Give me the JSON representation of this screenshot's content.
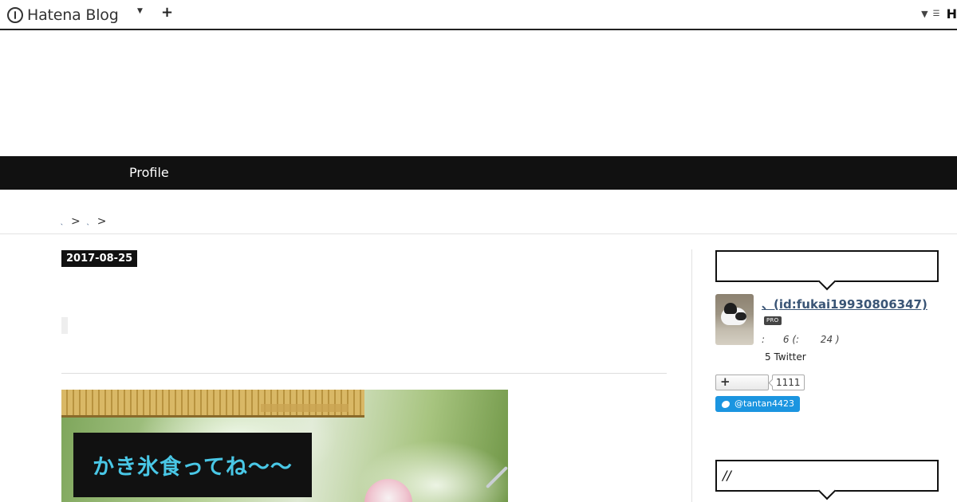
{
  "global_header": {
    "logo_text": "Hatena Blog",
    "logo_icon": "hatena-logo-icon",
    "menu_caret_icon": "caret-down-icon",
    "add_icon": "plus-icon",
    "right_caret_icon": "caret-down-icon",
    "right_menu_icon": "list-menu-icon",
    "right_text": "H"
  },
  "nav": {
    "items": [
      {
        "label": "Profile"
      }
    ]
  },
  "breadcrumb": {
    "separator": ">",
    "items": [
      {
        "label": "、"
      },
      {
        "label": "、"
      }
    ]
  },
  "entry": {
    "date": "2017-08-25",
    "hero": {
      "caption": "かき氷食ってね～～",
      "caption_color": "#49c7e6"
    }
  },
  "sidebar": {
    "profile_heading": "",
    "profile": {
      "name_link": "、(id:fukai19930806347)",
      "badge": "PRO",
      "stats": ":      6 (:       24 )",
      "twitter_line": "5 Twitter",
      "follow_icon": "plus-icon",
      "follow_count": "1111",
      "twitter_button": "@tantan4423",
      "twitter_icon": "twitter-bird-icon"
    },
    "second_heading": "//"
  },
  "colors": {
    "nav_bg": "#111111",
    "link": "#3a5576",
    "twitter_blue": "#1b95e0"
  }
}
